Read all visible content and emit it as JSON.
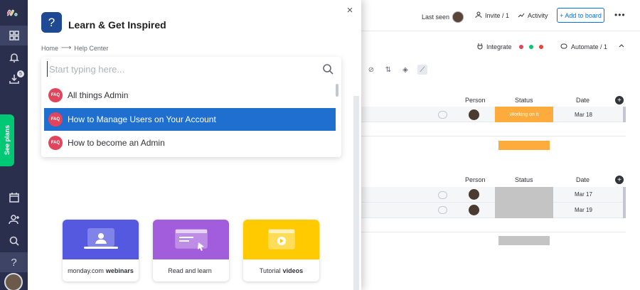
{
  "panel": {
    "title": "Learn & Get Inspired",
    "breadcrumb": [
      "Home",
      "Help Center"
    ],
    "close": "×",
    "help_glyph": "?"
  },
  "search": {
    "placeholder": "Start typing here...",
    "results": [
      {
        "badge": "FAQ",
        "label": "All things Admin",
        "selected": false
      },
      {
        "badge": "FAQ",
        "label": "How to Manage Users on Your Account",
        "selected": true
      },
      {
        "badge": "FAQ",
        "label": "How to become an Admin",
        "selected": false
      }
    ]
  },
  "cards": [
    {
      "label": "monday.com",
      "bold": "webinars",
      "color": "#5559df"
    },
    {
      "label": "Read and learn",
      "bold": "",
      "color": "#a25ddc"
    },
    {
      "label": "Tutorial",
      "bold": "videos",
      "color": "#ffcb00"
    }
  ],
  "rail": {
    "see_plans": "See plans",
    "badge_count": "5",
    "help_glyph": "?"
  },
  "topbar": {
    "last_seen": "Last seen",
    "invite": "Invite / 1",
    "activity": "Activity",
    "add_to_board": "+ Add to board",
    "more": "•••"
  },
  "subbar": {
    "integrate": "Integrate",
    "automate": "Automate / 1"
  },
  "groups": [
    {
      "columns": {
        "person": "Person",
        "status": "Status",
        "date": "Date"
      },
      "rows": [
        {
          "status": "Working on it",
          "status_color": "#fdab3d",
          "date": "Mar 18"
        }
      ],
      "summary_color": "#fdab3d"
    },
    {
      "columns": {
        "person": "Person",
        "status": "Status",
        "date": "Date"
      },
      "rows": [
        {
          "status": "",
          "status_color": "#c4c4c4",
          "date": "Mar 17"
        },
        {
          "status": "",
          "status_color": "#c4c4c4",
          "date": "Mar 19"
        }
      ],
      "summary_color": "#c4c4c4"
    }
  ],
  "colors": {
    "rail": "#292f4c",
    "accent": "#1f6fd1",
    "faq": "#e2445c",
    "green": "#00c875"
  }
}
